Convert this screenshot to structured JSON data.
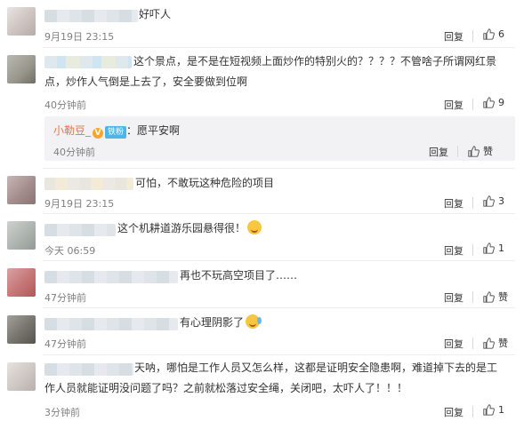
{
  "like_icon": "thumbs-up-icon",
  "comments": [
    {
      "text": "好吓人",
      "time": "9月19日 23:15",
      "reply_label": "回复",
      "likes": "6"
    },
    {
      "text_line1": "这个景点，是不是在短视频上面炒作的特别火的？？？？不管啥子所谓网红景",
      "text_line2": "点，炒作人气倒是上去了，安全要做到位啊",
      "time": "40分钟前",
      "reply_label": "回复",
      "likes": "9"
    },
    {
      "text": "可怕，不敢玩这种危险的项目",
      "time": "9月19日 23:15",
      "reply_label": "回复",
      "likes": "3"
    },
    {
      "text": "这个机耕道游乐园悬得很！",
      "time": "今天 06:59",
      "reply_label": "回复",
      "likes": "1"
    },
    {
      "text": "再也不玩高空项目了……",
      "time": "47分钟前",
      "reply_label": "回复",
      "likes": "赞"
    },
    {
      "text": "有心理阴影了",
      "time": "47分钟前",
      "reply_label": "回复",
      "likes": "赞"
    },
    {
      "text_line1": "天呐，哪怕是工作人员又怎么样，这都是证明安全隐患啊，难道掉下去的是工",
      "text_line2": "作人员就能证明没问题了吗？之前就松落过安全绳，关闭吧，太吓人了！！！",
      "time": "3分钟前",
      "reply_label": "回复",
      "likes": "1"
    }
  ],
  "subreply": {
    "name": "小勒豆_",
    "v_badge": "V",
    "fan_badge": "铁粉",
    "text": "：愿平安啊",
    "time": "40分钟前",
    "reply_label": "回复",
    "likes": "赞"
  }
}
